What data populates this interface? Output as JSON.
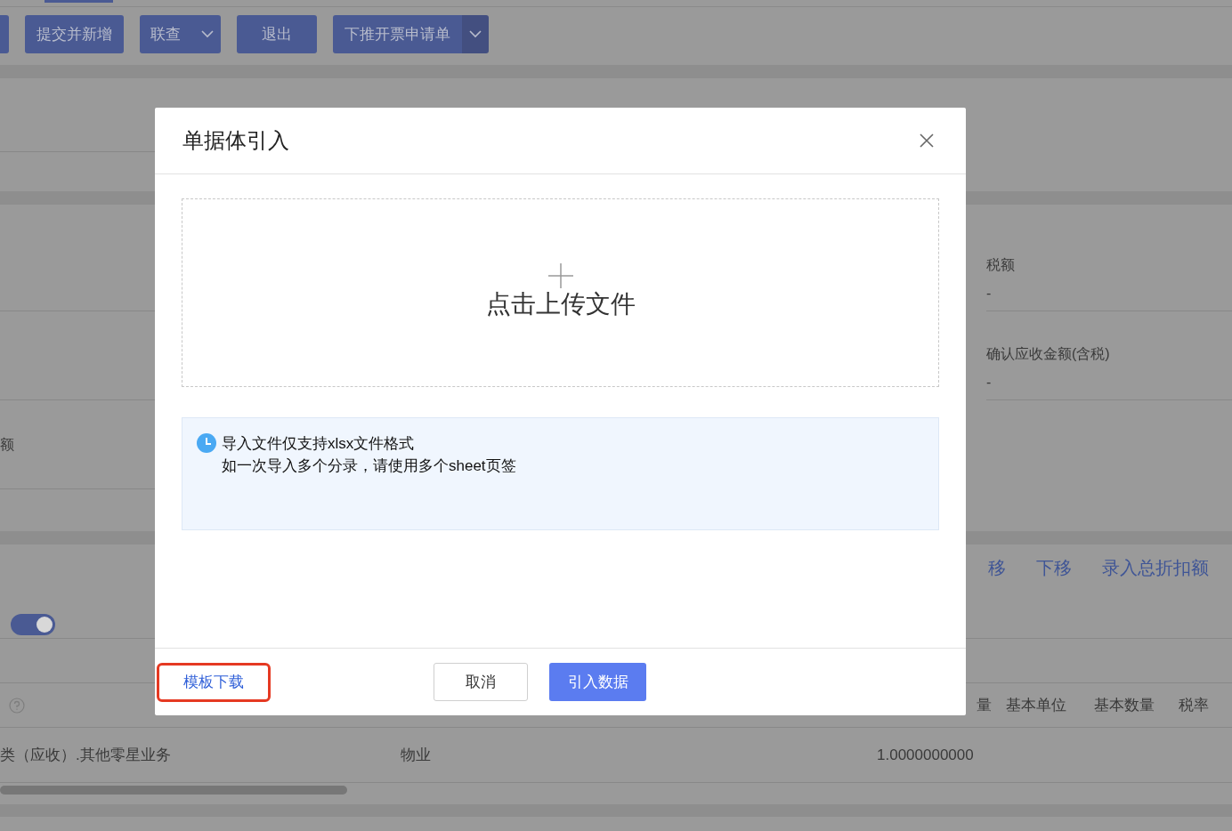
{
  "toolbar": {
    "buttons": [
      {
        "label": "提交并新增",
        "kind": "plain"
      },
      {
        "label": "联查",
        "kind": "dropdown"
      },
      {
        "label": "退出",
        "kind": "plain"
      },
      {
        "label": "下推开票申请单",
        "kind": "split"
      }
    ]
  },
  "form": {
    "left_label": "额",
    "fields": [
      {
        "label": "税额",
        "value": "-"
      },
      {
        "label": "确认应收金额(含税)",
        "value": "-"
      }
    ],
    "toggle": {
      "on": true
    }
  },
  "entry_actions": [
    "移",
    "下移",
    "录入总折扣额"
  ],
  "table": {
    "columns": [
      "量",
      "基本单位",
      "基本数量",
      "税率"
    ],
    "rows": [
      {
        "cells": [
          "类（应收）.其他零星业务",
          "物业",
          "1.0000000000"
        ]
      }
    ]
  },
  "dialog": {
    "title": "单据体引入",
    "upload_text": "点击上传文件",
    "notes": [
      "导入文件仅支持xlsx文件格式",
      "如一次导入多个分录，请使用多个sheet页签"
    ],
    "buttons": [
      {
        "label": "模板下载",
        "kind": "link",
        "highlighted": true
      },
      {
        "label": "取消",
        "kind": "default",
        "highlighted": false
      },
      {
        "label": "引入数据",
        "kind": "primary",
        "highlighted": false
      }
    ]
  }
}
